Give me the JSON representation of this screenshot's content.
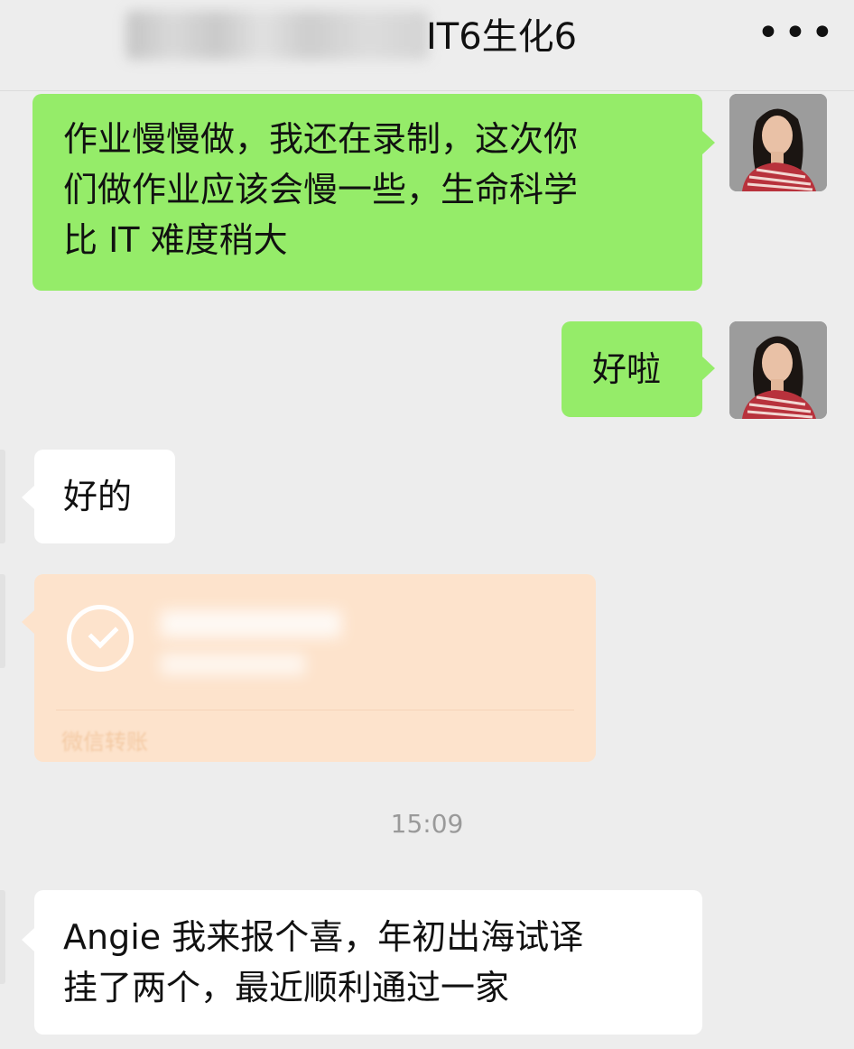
{
  "header": {
    "title": "IT6生化6",
    "more_label": "•••"
  },
  "messages": [
    {
      "side": "right",
      "text_lines": [
        "作业慢慢做，我还在录制，这次你",
        "们做作业应该会慢一些，生命科学",
        "比 IT 难度稍大"
      ]
    },
    {
      "side": "right",
      "text": "好啦"
    },
    {
      "side": "left",
      "text": "好的"
    },
    {
      "side": "left",
      "type": "transfer",
      "label": "微信转账"
    },
    {
      "type": "timestamp",
      "text": "15:09"
    },
    {
      "side": "left",
      "text_lines": [
        "Angie 我来报个喜，年初出海试译",
        "挂了两个，最近顺利通过一家"
      ]
    }
  ],
  "colors": {
    "background": "#ededed",
    "sent_bubble": "#95ec69",
    "received_bubble": "#ffffff",
    "transfer_card": "#fde3cc",
    "timestamp_text": "#9a9a9a"
  }
}
